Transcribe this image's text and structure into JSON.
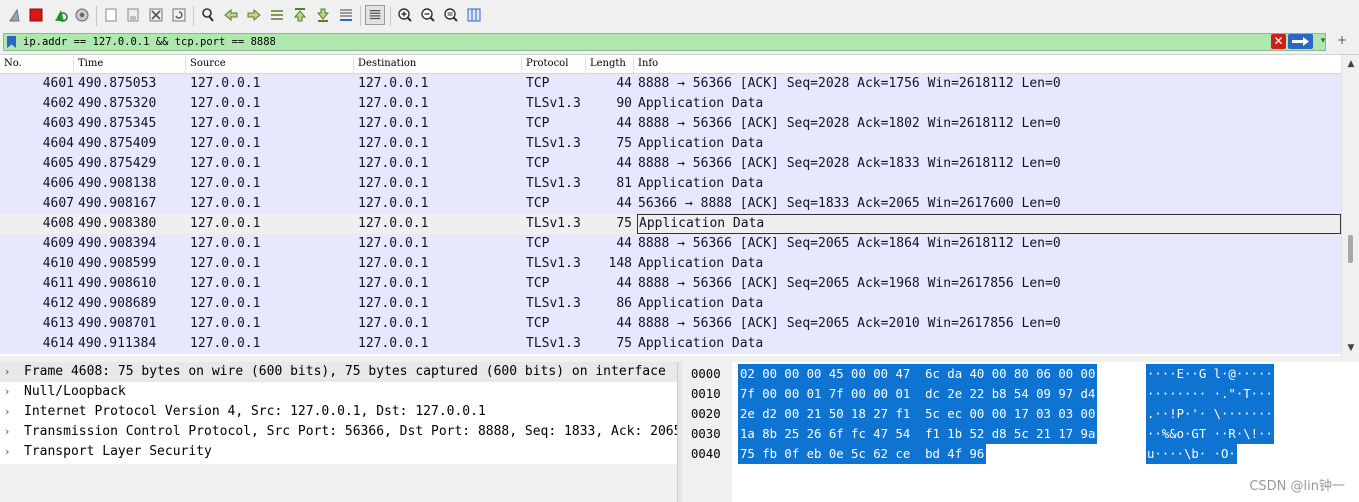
{
  "colors": {
    "accent": "#0f74d1",
    "filter_bg": "#aee8ae",
    "row_bg": "#e8e8fc",
    "row_selected": "#efefef"
  },
  "toolbar": {
    "icons": [
      "shark-fin-start-icon",
      "stop-capture-icon",
      "restart-capture-icon",
      "capture-options-icon",
      "open-file-icon",
      "save-file-icon",
      "close-file-icon",
      "reload-file-icon",
      "find-packet-icon",
      "go-back-icon",
      "go-forward-icon",
      "go-to-packet-icon",
      "go-first-icon",
      "go-last-icon",
      "autoscroll-icon",
      "colorize-icon",
      "zoom-in-icon",
      "zoom-out-icon",
      "zoom-normal-icon",
      "resize-columns-icon"
    ]
  },
  "filter": {
    "value": "ip.addr == 127.0.0.1 && tcp.port == 8888"
  },
  "columns": [
    "No.",
    "Time",
    "Source",
    "Destination",
    "Protocol",
    "Length",
    "Info"
  ],
  "packets": [
    {
      "no": "4601",
      "time": "490.875053",
      "src": "127.0.0.1",
      "dst": "127.0.0.1",
      "proto": "TCP",
      "len": "44",
      "info": "8888 → 56366 [ACK] Seq=2028 Ack=1756 Win=2618112 Len=0"
    },
    {
      "no": "4602",
      "time": "490.875320",
      "src": "127.0.0.1",
      "dst": "127.0.0.1",
      "proto": "TLSv1.3",
      "len": "90",
      "info": "Application Data"
    },
    {
      "no": "4603",
      "time": "490.875345",
      "src": "127.0.0.1",
      "dst": "127.0.0.1",
      "proto": "TCP",
      "len": "44",
      "info": "8888 → 56366 [ACK] Seq=2028 Ack=1802 Win=2618112 Len=0"
    },
    {
      "no": "4604",
      "time": "490.875409",
      "src": "127.0.0.1",
      "dst": "127.0.0.1",
      "proto": "TLSv1.3",
      "len": "75",
      "info": "Application Data"
    },
    {
      "no": "4605",
      "time": "490.875429",
      "src": "127.0.0.1",
      "dst": "127.0.0.1",
      "proto": "TCP",
      "len": "44",
      "info": "8888 → 56366 [ACK] Seq=2028 Ack=1833 Win=2618112 Len=0"
    },
    {
      "no": "4606",
      "time": "490.908138",
      "src": "127.0.0.1",
      "dst": "127.0.0.1",
      "proto": "TLSv1.3",
      "len": "81",
      "info": "Application Data"
    },
    {
      "no": "4607",
      "time": "490.908167",
      "src": "127.0.0.1",
      "dst": "127.0.0.1",
      "proto": "TCP",
      "len": "44",
      "info": "56366 → 8888 [ACK] Seq=1833 Ack=2065 Win=2617600 Len=0"
    },
    {
      "no": "4608",
      "time": "490.908380",
      "src": "127.0.0.1",
      "dst": "127.0.0.1",
      "proto": "TLSv1.3",
      "len": "75",
      "info": "Application Data",
      "selected": true
    },
    {
      "no": "4609",
      "time": "490.908394",
      "src": "127.0.0.1",
      "dst": "127.0.0.1",
      "proto": "TCP",
      "len": "44",
      "info": "8888 → 56366 [ACK] Seq=2065 Ack=1864 Win=2618112 Len=0"
    },
    {
      "no": "4610",
      "time": "490.908599",
      "src": "127.0.0.1",
      "dst": "127.0.0.1",
      "proto": "TLSv1.3",
      "len": "148",
      "info": "Application Data"
    },
    {
      "no": "4611",
      "time": "490.908610",
      "src": "127.0.0.1",
      "dst": "127.0.0.1",
      "proto": "TCP",
      "len": "44",
      "info": "8888 → 56366 [ACK] Seq=2065 Ack=1968 Win=2617856 Len=0"
    },
    {
      "no": "4612",
      "time": "490.908689",
      "src": "127.0.0.1",
      "dst": "127.0.0.1",
      "proto": "TLSv1.3",
      "len": "86",
      "info": "Application Data"
    },
    {
      "no": "4613",
      "time": "490.908701",
      "src": "127.0.0.1",
      "dst": "127.0.0.1",
      "proto": "TCP",
      "len": "44",
      "info": "8888 → 56366 [ACK] Seq=2065 Ack=2010 Win=2617856 Len=0"
    },
    {
      "no": "4614",
      "time": "490.911384",
      "src": "127.0.0.1",
      "dst": "127.0.0.1",
      "proto": "TLSv1.3",
      "len": "75",
      "info": "Application Data"
    }
  ],
  "details": [
    {
      "text": "Frame 4608: 75 bytes on wire (600 bits), 75 bytes captured (600 bits) on interface",
      "selected": true
    },
    {
      "text": "Null/Loopback"
    },
    {
      "text": "Internet Protocol Version 4, Src: 127.0.0.1, Dst: 127.0.0.1"
    },
    {
      "text": "Transmission Control Protocol, Src Port: 56366, Dst Port: 8888, Seq: 1833, Ack: 2065"
    },
    {
      "text": "Transport Layer Security"
    }
  ],
  "bytes": [
    {
      "offset": "0000",
      "hex": "02 00 00 00 45 00 00 47  6c da 40 00 80 06 00 00",
      "ascii": "····E··G l·@·····"
    },
    {
      "offset": "0010",
      "hex": "7f 00 00 01 7f 00 00 01  dc 2e 22 b8 54 09 97 d4",
      "ascii": "········ ·.\"·T···"
    },
    {
      "offset": "0020",
      "hex": "2e d2 00 21 50 18 27 f1  5c ec 00 00 17 03 03 00",
      "ascii": ".··!P·'· \\·······"
    },
    {
      "offset": "0030",
      "hex": "1a 8b 25 26 6f fc 47 54  f1 1b 52 d8 5c 21 17 9a",
      "ascii": "··%&o·GT ··R·\\!··"
    },
    {
      "offset": "0040",
      "hex": "75 fb 0f eb 0e 5c 62 ce  bd 4f 96",
      "ascii": "u····\\b· ·O·"
    }
  ],
  "watermark": "CSDN @lin钟一"
}
